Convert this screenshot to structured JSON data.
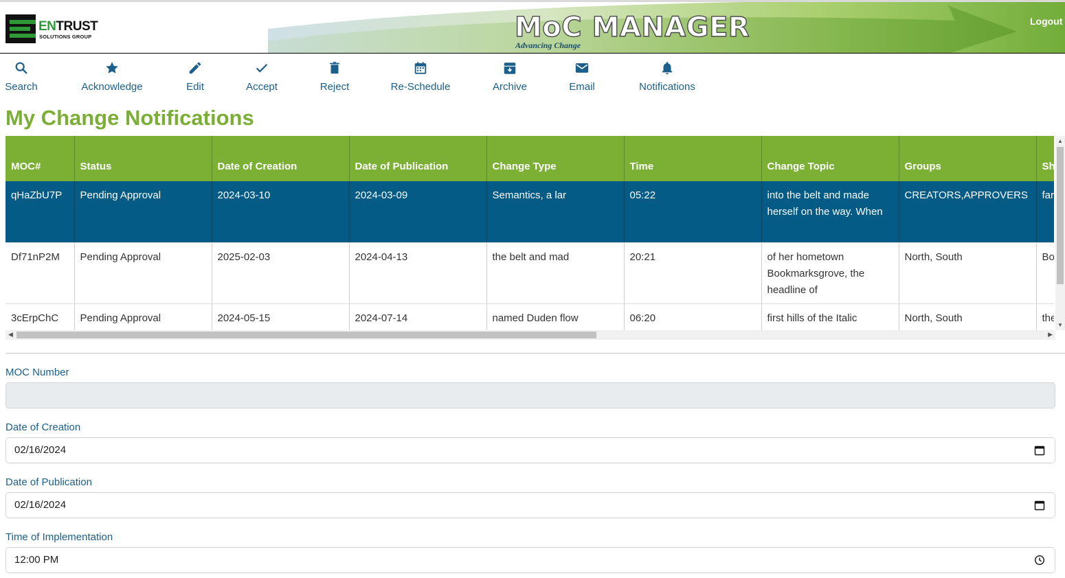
{
  "header": {
    "logo_word": "ENTRUST",
    "logo_sub": "SOLUTIONS GROUP",
    "app_title": "MoC MANAGER",
    "app_subtitle": "Advancing Change",
    "logout_label": "Logout",
    "colors": {
      "brand_green": "#7cb034",
      "brand_blue": "#1b5f8a",
      "selected_row": "#035b86"
    }
  },
  "toolbar": {
    "items": [
      {
        "label": "Search",
        "icon": "search-icon"
      },
      {
        "label": "Acknowledge",
        "icon": "star-icon"
      },
      {
        "label": "Edit",
        "icon": "pencil-icon"
      },
      {
        "label": "Accept",
        "icon": "check-icon"
      },
      {
        "label": "Reject",
        "icon": "trash-icon"
      },
      {
        "label": "Re-Schedule",
        "icon": "calendar-icon"
      },
      {
        "label": "Archive",
        "icon": "archive-icon"
      },
      {
        "label": "Email",
        "icon": "envelope-icon"
      },
      {
        "label": "Notifications",
        "icon": "bell-icon"
      }
    ]
  },
  "page": {
    "title": "My Change Notifications"
  },
  "table": {
    "columns": [
      "MOC#",
      "Status",
      "Date of Creation",
      "Date of Publication",
      "Change Type",
      "Time",
      "Change Topic",
      "Groups",
      "Sh"
    ],
    "rows": [
      {
        "selected": true,
        "cells": [
          "qHaZbU7P",
          "Pending Approval",
          "2024-03-10",
          "2024-03-09",
          "Semantics, a lar",
          "05:22",
          "into the belt and made herself on the way. When",
          "CREATORS,APPROVERS",
          "far wo the"
        ]
      },
      {
        "selected": false,
        "cells": [
          "Df71nP2M",
          "Pending Approval",
          "2025-02-03",
          "2024-04-13",
          "the belt and mad",
          "20:21",
          "of her hometown Bookmarksgrove, the headline of",
          "North, South",
          "Bo he Vil"
        ]
      },
      {
        "selected": false,
        "cells": [
          "3cErpChC",
          "Pending Approval",
          "2024-05-15",
          "2024-07-14",
          "named Duden flow",
          "06:20",
          "first hills of the Italic",
          "North, South",
          "the"
        ]
      }
    ]
  },
  "form": {
    "moc_number": {
      "label": "MOC Number",
      "value": ""
    },
    "date_of_creation": {
      "label": "Date of Creation",
      "value": "02/16/2024",
      "icon": "calendar-icon"
    },
    "date_of_publication": {
      "label": "Date of Publication",
      "value": "02/16/2024",
      "icon": "calendar-icon"
    },
    "time_of_implementation": {
      "label": "Time of Implementation",
      "value": "12:00 PM",
      "icon": "clock-icon"
    }
  }
}
